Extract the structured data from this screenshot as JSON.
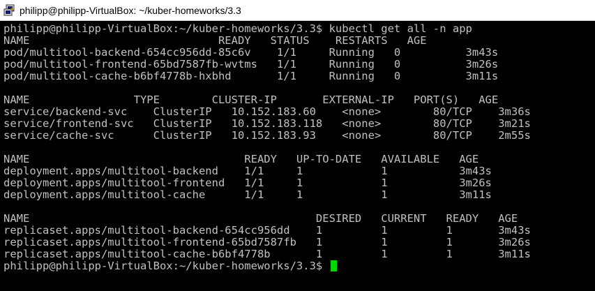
{
  "window": {
    "title": "philipp@philipp-VirtualBox: ~/kuber-homeworks/3.3",
    "icon": "putty-terminal-icon"
  },
  "terminal": {
    "colors": {
      "background": "#000000",
      "text": "#c0c0c0",
      "cursor": "#00d800"
    },
    "lines": [
      "philipp@philipp-VirtualBox:~/kuber-homeworks/3.3$ kubectl get all -n app",
      "NAME                             READY   STATUS    RESTARTS   AGE",
      "pod/multitool-backend-654cc956dd-85c6v    1/1     Running   0          3m43s",
      "pod/multitool-frontend-65bd7587fb-wvtms   1/1     Running   0          3m26s",
      "pod/multitool-cache-b6bf4778b-hxbhd       1/1     Running   0          3m11s",
      "",
      "NAME                TYPE        CLUSTER-IP       EXTERNAL-IP   PORT(S)   AGE",
      "service/backend-svc    ClusterIP   10.152.183.60    <none>        80/TCP    3m36s",
      "service/frontend-svc   ClusterIP   10.152.183.118   <none>        80/TCP    3m21s",
      "service/cache-svc      ClusterIP   10.152.183.93    <none>        80/TCP    2m55s",
      "",
      "NAME                                 READY   UP-TO-DATE   AVAILABLE   AGE",
      "deployment.apps/multitool-backend    1/1     1            1           3m43s",
      "deployment.apps/multitool-frontend   1/1     1            1           3m26s",
      "deployment.apps/multitool-cache      1/1     1            1           3m11s",
      "",
      "NAME                                            DESIRED   CURRENT   READY   AGE",
      "replicaset.apps/multitool-backend-654cc956dd    1         1         1       3m43s",
      "replicaset.apps/multitool-frontend-65bd7587fb   1         1         1       3m26s",
      "replicaset.apps/multitool-cache-b6bf4778b       1         1         1       3m11s"
    ],
    "prompt": "philipp@philipp-VirtualBox:~/kuber-homeworks/3.3$ "
  }
}
